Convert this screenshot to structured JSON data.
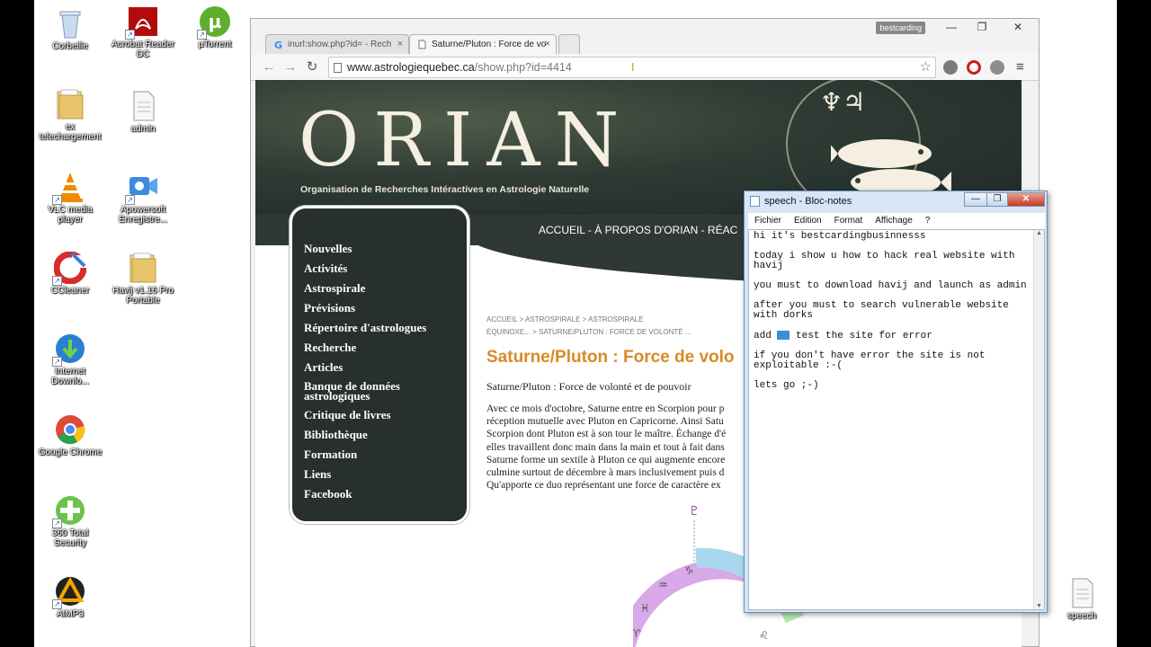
{
  "desktop": {
    "icons": [
      {
        "label": "Corbeille",
        "icon": "recycle-bin-icon",
        "color": "#9bb6d4"
      },
      {
        "label": "Acrobat Reader DC",
        "icon": "acrobat-icon",
        "color": "#c4161c"
      },
      {
        "label": "µTorrent",
        "icon": "utorrent-icon",
        "color": "#5fae2e"
      },
      {
        "label": "ex telechargement",
        "icon": "folder-icon",
        "color": "#e8c46a"
      },
      {
        "label": "admin",
        "icon": "text-file-icon",
        "color": "#f4f4f4"
      },
      {
        "label": "VLC media player",
        "icon": "vlc-icon",
        "color": "#f08a00"
      },
      {
        "label": "Apowersoft Enregistre...",
        "icon": "apowersoft-icon",
        "color": "#3c8be0"
      },
      {
        "label": "CCleaner",
        "icon": "ccleaner-icon",
        "color": "#d92b2b"
      },
      {
        "label": "Havij v1.16 Pro Portable",
        "icon": "folder-icon",
        "color": "#e8c46a"
      },
      {
        "label": "Internet Downlo...",
        "icon": "idm-icon",
        "color": "#2e9e48"
      },
      {
        "label": "Google Chrome",
        "icon": "chrome-icon",
        "color": "#dd4b39"
      },
      {
        "label": "360 Total Security",
        "icon": "360-security-icon",
        "color": "#6cc24a"
      },
      {
        "label": "AIMP3",
        "icon": "aimp-icon",
        "color": "#f2a400"
      },
      {
        "label": "speech",
        "icon": "text-file-icon",
        "color": "#f4f4f4"
      }
    ]
  },
  "browser": {
    "tabs": [
      {
        "label": "inurl:show.php?id= - Rech",
        "active": false
      },
      {
        "label": "Saturne/Pluton : Force de vo",
        "active": true
      }
    ],
    "user_badge": "bestcarding",
    "window_buttons": {
      "minimize": "—",
      "maximize": "❐",
      "close": "✕"
    },
    "url_host": "www.astrologiequebec.ca",
    "url_path": "/show.php?id=4414"
  },
  "site": {
    "logo": "ORIAN",
    "tagline": "Organisation de Recherches Intéractives en Astrologie Naturelle",
    "banner_glyphs": "♆♃",
    "nav": {
      "accueil": "ACCUEIL",
      "sep1": " - ",
      "apropos": "À PROPOS D'ORIAN",
      "sep2": " - ",
      "reac": "RÉAC"
    },
    "menu": [
      "Nouvelles",
      "Activités",
      "Astrospirale",
      "Prévisions",
      "Répertoire d'astrologues",
      "Recherche",
      "Articles",
      "Banque de données astrologiques",
      "Critique de livres",
      "Bibliothèque",
      "Formation",
      "Liens",
      "Facebook"
    ],
    "breadcrumb_line1": "ACCUEIL > ASTROSPIRALE > ASTROSPIRALE",
    "breadcrumb_line2": "ÉQUINOXE... > SATURNE/PLUTON : FORCE DE VOLONTÉ ...",
    "title": "Saturne/Pluton : Force de volo",
    "subtitle": "Saturne/Pluton : Force de volonté et de pouvoir",
    "body_lines": [
      "Avec ce mois d'octobre, Saturne entre en Scorpion pour p",
      "réception mutuelle avec Pluton en Capricorne. Ainsi Satu",
      "Scorpion dont Pluton est à son tour le maître. Échange d'é",
      "elles travaillent donc main dans la main et tout à fait dans",
      "Saturne forme un sextile à Pluton ce qui augmente encore",
      "culmine surtout de décembre à mars inclusivement puis d",
      "Qu'apporte ce duo représentant une force de caractère ex"
    ],
    "chart_symbols": {
      "top": "♇",
      "capricorn": "♑",
      "aquarius": "♒",
      "pisces": "♓",
      "aries": "♈",
      "leo": "♌"
    }
  },
  "notepad": {
    "title": "speech - Bloc-notes",
    "menu": [
      "Fichier",
      "Edition",
      "Format",
      "Affichage",
      "?"
    ],
    "lines": [
      "hi it's bestcardingbusinnesss",
      "today i show u how to hack real website with havij",
      "you must to download havij and launch as admin",
      "after you must to search vulnerable website with dorks",
      "add",
      "test the site for error",
      "if you don't have error  the site is not exploitable :-(",
      "lets go ;-)"
    ]
  }
}
